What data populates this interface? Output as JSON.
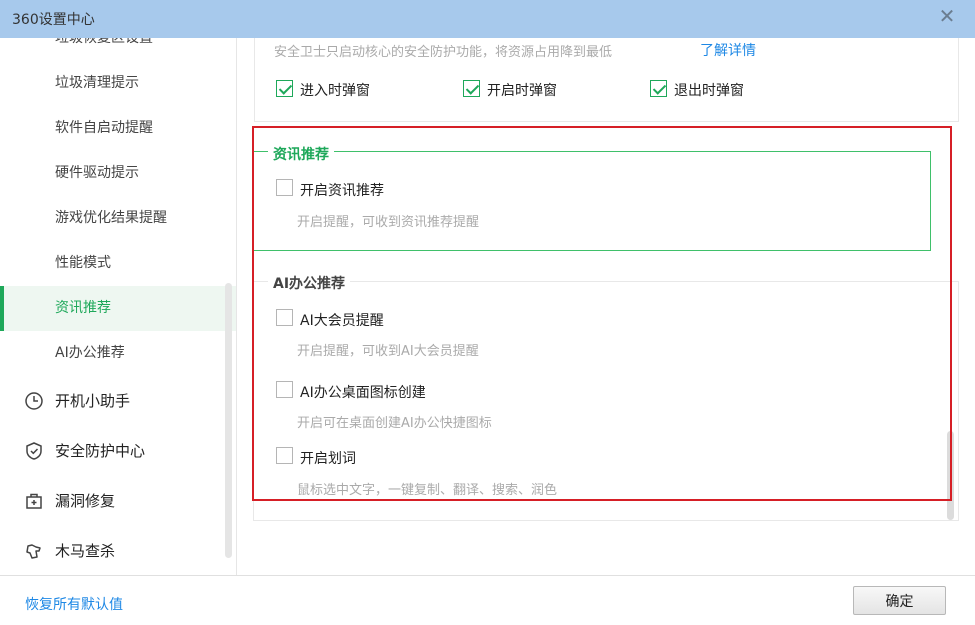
{
  "window": {
    "title": "360设置中心",
    "close_glyph": "✕"
  },
  "sidebar": {
    "sub_items": [
      {
        "label": "垃圾恢复区设置"
      },
      {
        "label": "垃圾清理提示"
      },
      {
        "label": "软件自启动提醒"
      },
      {
        "label": "硬件驱动提示"
      },
      {
        "label": "游戏优化结果提醒"
      },
      {
        "label": "性能模式"
      },
      {
        "label": "资讯推荐",
        "active": true
      },
      {
        "label": "AI办公推荐"
      }
    ],
    "top_items": [
      {
        "label": "开机小助手",
        "icon": "clock-icon"
      },
      {
        "label": "安全防护中心",
        "icon": "shield-check-icon"
      },
      {
        "label": "漏洞修复",
        "icon": "medical-kit-icon"
      },
      {
        "label": "木马查杀",
        "icon": "horse-icon"
      }
    ]
  },
  "top_section": {
    "description": "安全卫士只启动核心的安全防护功能，将资源占用降到最低",
    "link": "了解详情",
    "checkboxes": [
      {
        "label": "进入时弹窗",
        "checked": true
      },
      {
        "label": "开启时弹窗",
        "checked": true
      },
      {
        "label": "退出时弹窗",
        "checked": true
      }
    ]
  },
  "news_section": {
    "title": "资讯推荐",
    "option": {
      "label": "开启资讯推荐",
      "hint": "开启提醒，可收到资讯推荐提醒",
      "checked": false
    }
  },
  "ai_section": {
    "title": "AI办公推荐",
    "options": [
      {
        "label": "AI大会员提醒",
        "hint": "开启提醒，可收到AI大会员提醒",
        "checked": false
      },
      {
        "label": "AI办公桌面图标创建",
        "hint": "开启可在桌面创建AI办公快捷图标",
        "checked": false
      },
      {
        "label": "开启划词",
        "hint": "鼠标选中文字，一键复制、翻译、搜索、润色",
        "checked": false
      }
    ]
  },
  "footer": {
    "restore_label": "恢复所有默认值",
    "ok_label": "确定"
  },
  "colors": {
    "accent_green": "#1ea85a",
    "title_bar": "#a7c9ec",
    "link_blue": "#1e88e5",
    "highlight_red": "#d61f26"
  }
}
